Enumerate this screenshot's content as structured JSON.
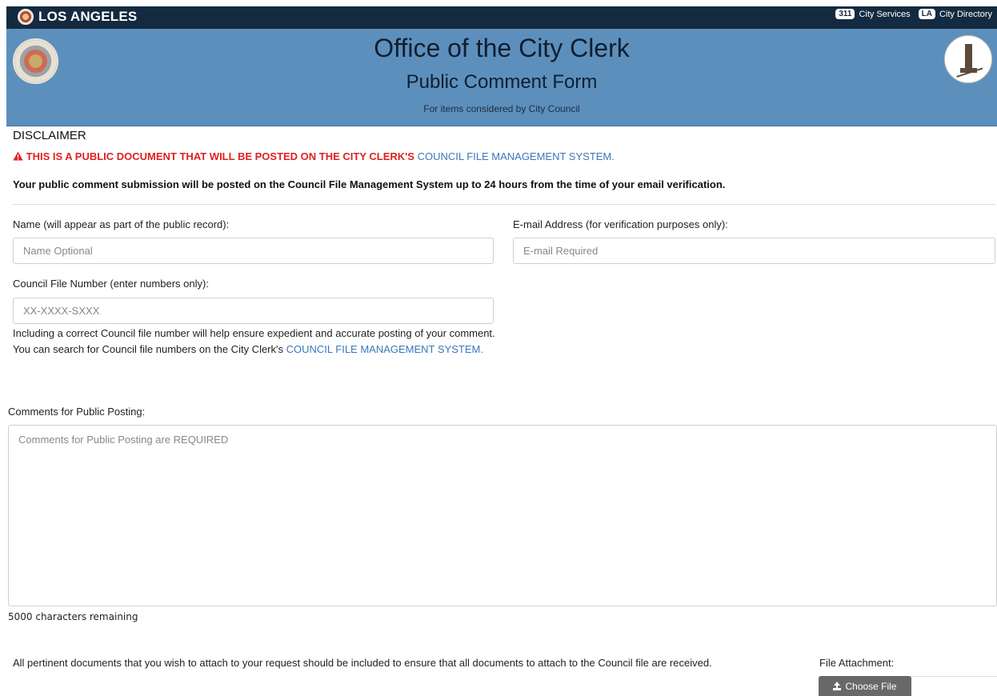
{
  "topbar": {
    "brand": "LOS ANGELES",
    "links": [
      {
        "badge": "311",
        "label": "City Services"
      },
      {
        "badge": "LA",
        "label": "City Directory"
      }
    ]
  },
  "header": {
    "title": "Office of the City Clerk",
    "subtitle": "Public Comment Form",
    "note": "For items considered by City Council"
  },
  "disclaimer": {
    "title": "DISCLAIMER",
    "warning_text": "THIS IS A PUBLIC DOCUMENT THAT WILL BE POSTED ON THE CITY CLERK'S",
    "warning_link": "COUNCIL FILE MANAGEMENT SYSTEM.",
    "notice": "Your public comment submission will be posted on the Council File Management System up to 24 hours from the time of your email verification."
  },
  "form": {
    "name_label": "Name (will appear as part of the public record):",
    "name_placeholder": "Name Optional",
    "email_label": "E-mail Address (for verification purposes only):",
    "email_placeholder": "E-mail Required",
    "council_label": "Council File Number (enter numbers only):",
    "council_placeholder": "XX-XXXX-SXXX",
    "help_text": "Including a correct Council file number will help ensure expedient and accurate posting of your comment.",
    "search_text": "You can search for Council file numbers on the City Clerk's",
    "search_link": "COUNCIL FILE MANAGEMENT SYSTEM.",
    "comments_label": "Comments for Public Posting:",
    "comments_placeholder": "Comments for Public Posting are REQUIRED",
    "remaining": "5000 characters remaining",
    "attach_note": "All pertinent documents that you wish to attach to your request should be included to ensure that all documents to attach to the Council file are received.",
    "attach_label": "File Attachment:",
    "choose_file": "Choose File"
  },
  "colors": {
    "topbar": "#142a40",
    "header": "#5d8fbd",
    "warning": "#e02020",
    "link": "#3b77b8"
  },
  "icons": [
    "city-seal-icon",
    "warning-icon",
    "upload-icon"
  ]
}
